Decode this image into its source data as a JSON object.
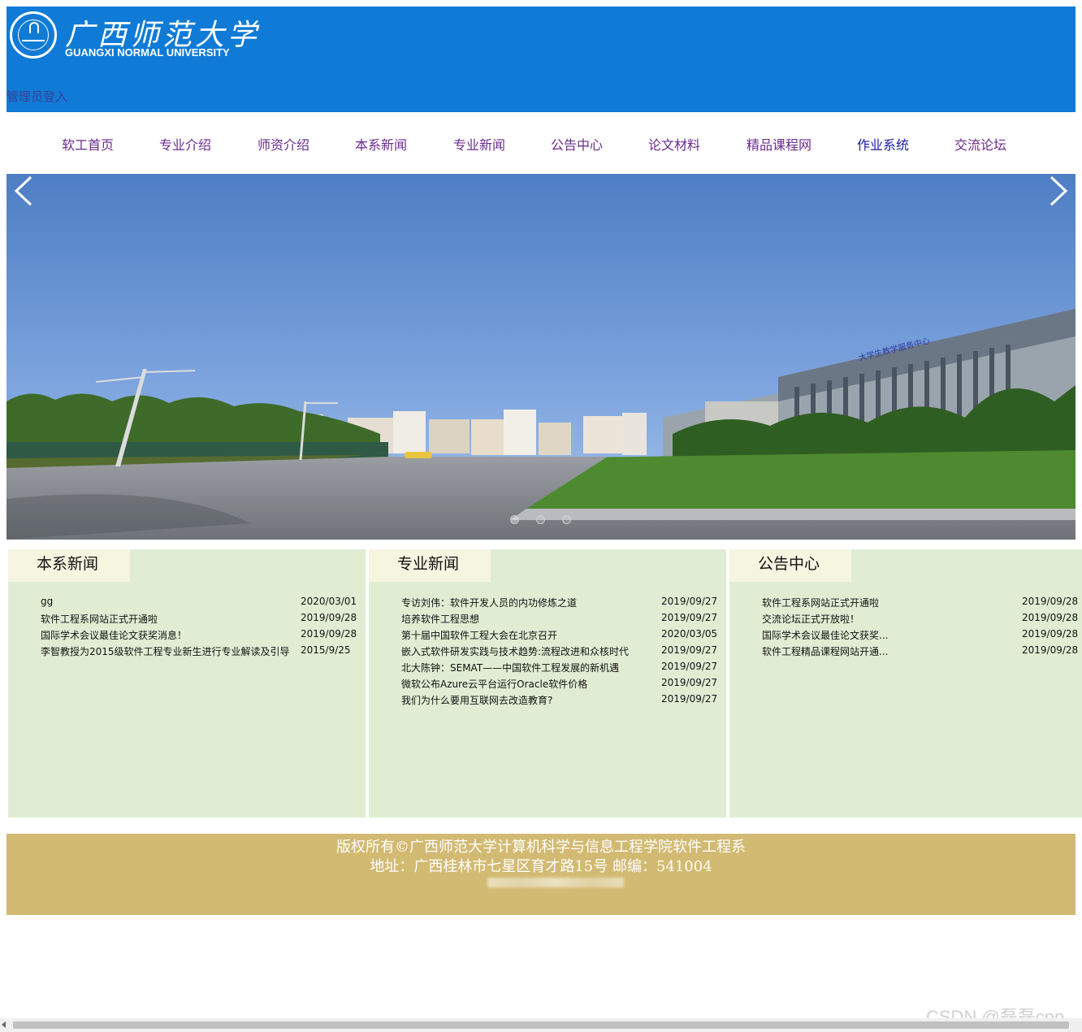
{
  "header": {
    "logo_cn": "广西师范大学",
    "logo_en": "GUANGXI NORMAL UNIVERSITY",
    "admin_login": "管理员登入"
  },
  "nav": [
    {
      "label": "软工首页"
    },
    {
      "label": "专业介绍"
    },
    {
      "label": "师资介绍"
    },
    {
      "label": "本系新闻"
    },
    {
      "label": "专业新闻"
    },
    {
      "label": "公告中心"
    },
    {
      "label": "论文材料"
    },
    {
      "label": "精品课程网"
    },
    {
      "label": "作业系统"
    },
    {
      "label": "交流论坛"
    }
  ],
  "carousel": {
    "active_slide": 1,
    "slide_count": 3,
    "building_sign": "大学生教学服务中心"
  },
  "panels": [
    {
      "title": "本系新闻",
      "items": [
        {
          "title": "gg",
          "date": "2020/03/01"
        },
        {
          "title": "软件工程系网站正式开通啦",
          "date": "2019/09/28"
        },
        {
          "title": "国际学术会议最佳论文获奖消息！",
          "date": "2019/09/28"
        },
        {
          "title": "李智教授为2015级软件工程专业新生进行专业解读及引导",
          "date": "2015/9/25"
        }
      ]
    },
    {
      "title": "专业新闻",
      "items": [
        {
          "title": "专访刘伟：软件开发人员的内功修炼之道",
          "date": "2019/09/27"
        },
        {
          "title": "培养软件工程思想",
          "date": "2019/09/27"
        },
        {
          "title": "第十届中国软件工程大会在北京召开",
          "date": "2020/03/05"
        },
        {
          "title": "嵌入式软件研发实践与技术趋势:流程改进和众核时代",
          "date": "2019/09/27"
        },
        {
          "title": "北大陈钟：SEMAT——中国软件工程发展的新机遇",
          "date": "2019/09/27"
        },
        {
          "title": "微软公布Azure云平台运行Oracle软件价格",
          "date": "2019/09/27"
        },
        {
          "title": "我们为什么要用互联网去改造教育?",
          "date": "2019/09/27"
        }
      ]
    },
    {
      "title": "公告中心",
      "items": [
        {
          "title": "软件工程系网站正式开通啦",
          "date": "2019/09/28"
        },
        {
          "title": "交流论坛正式开放啦！",
          "date": "2019/09/28"
        },
        {
          "title": "国际学术会议最佳论文获奖...",
          "date": "2019/09/28"
        },
        {
          "title": "软件工程精品课程网站开通...",
          "date": "2019/09/28"
        }
      ]
    }
  ],
  "footer": {
    "copyright": "版权所有©广西师范大学计算机科学与信息工程学院软件工程系",
    "address": "地址：广西桂林市七星区育才路15号 邮编：541004"
  },
  "watermark": "CSDN @磊磊cpp",
  "colors": {
    "header_bg": "#0f7bd6",
    "nav_link": "#6a2b8e",
    "panel_bg": "#e1edd3",
    "panel_tab_bg": "#f5f5e0",
    "footer_bg": "#d2ba72"
  }
}
